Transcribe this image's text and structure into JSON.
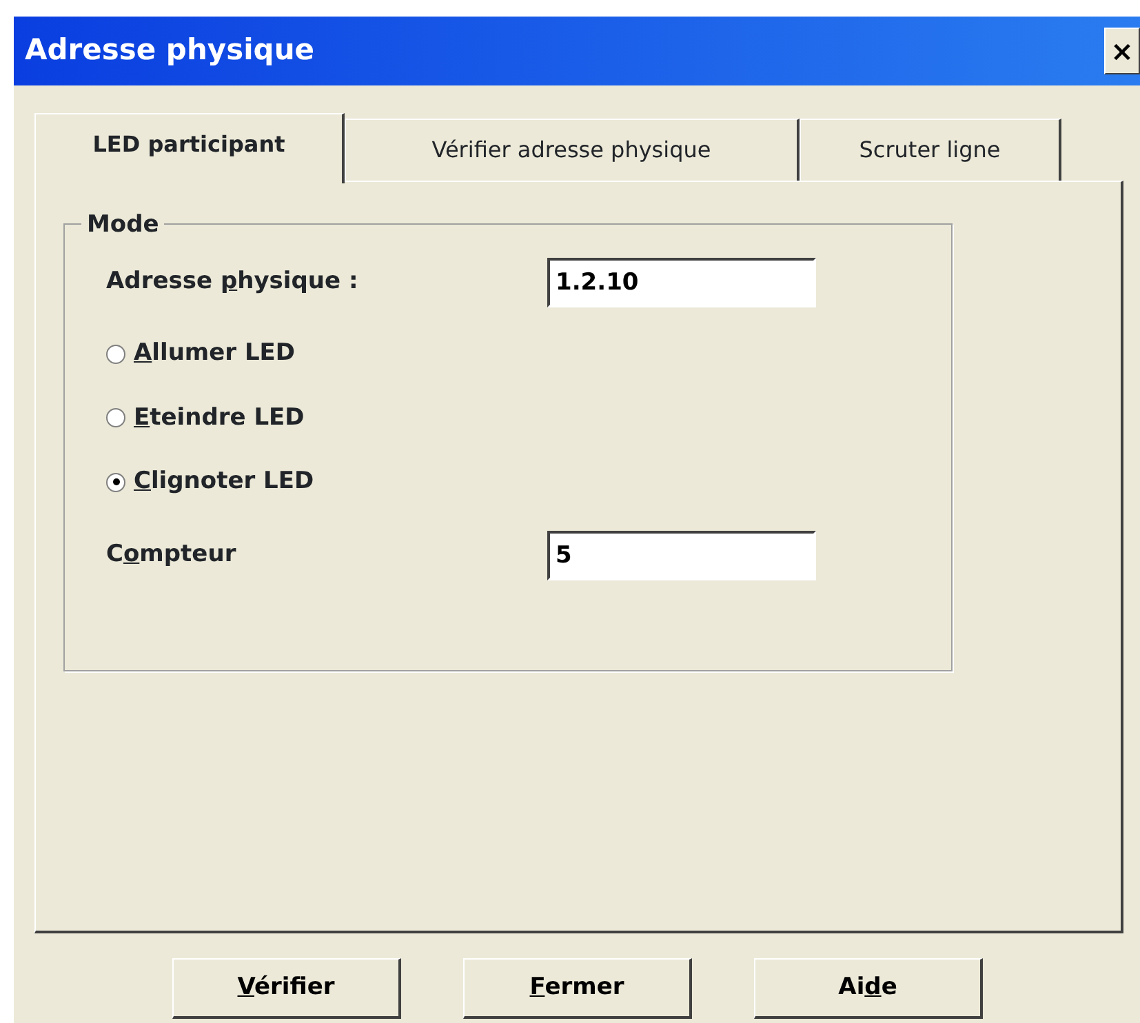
{
  "window": {
    "title": "Adresse physique",
    "close": "×"
  },
  "tabs": [
    {
      "label": "LED participant",
      "selected": true
    },
    {
      "label": "Vérifier adresse physique",
      "selected": false
    },
    {
      "label": "Scruter ligne",
      "selected": false
    }
  ],
  "group": {
    "title": "Mode",
    "address": {
      "label": {
        "pre": "Adresse ",
        "key": "p",
        "post": "hysique :"
      },
      "value": "1.2.10"
    },
    "radios": [
      {
        "label": {
          "key": "A",
          "post": "llumer LED"
        },
        "selected": false
      },
      {
        "label": {
          "key": "E",
          "post": "teindre LED"
        },
        "selected": false
      },
      {
        "label": {
          "key": "C",
          "post": "lignoter LED"
        },
        "selected": true
      }
    ],
    "counter": {
      "label": {
        "pre": "C",
        "key": "o",
        "post": "mpteur"
      },
      "value": "5"
    }
  },
  "buttons": [
    {
      "label": {
        "key": "V",
        "post": "érifier"
      }
    },
    {
      "label": {
        "key": "F",
        "post": "ermer"
      }
    },
    {
      "label": {
        "pre": "Ai",
        "key": "d",
        "post": "e"
      }
    }
  ]
}
